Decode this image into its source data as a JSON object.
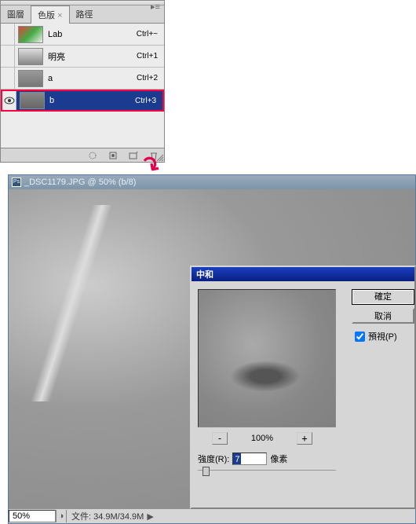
{
  "panel": {
    "tabs": [
      "圖層",
      "色版",
      "路徑"
    ],
    "active_tab_index": 1,
    "channels": [
      {
        "name": "Lab",
        "shortcut": "Ctrl+~",
        "thumb": "lab",
        "visible": false,
        "selected": false
      },
      {
        "name": "明亮",
        "shortcut": "Ctrl+1",
        "thumb": "light",
        "visible": false,
        "selected": false
      },
      {
        "name": "a",
        "shortcut": "Ctrl+2",
        "thumb": "a",
        "visible": false,
        "selected": false
      },
      {
        "name": "b",
        "shortcut": "Ctrl+3",
        "thumb": "b",
        "visible": true,
        "selected": true
      }
    ]
  },
  "document": {
    "title": "_DSC1179.JPG @ 50% (b/8)",
    "zoom": "50%",
    "status": "文件: 34.9M/34.9M"
  },
  "dialog": {
    "title": "中和",
    "ok": "確定",
    "cancel": "取消",
    "preview_label": "預視(P)",
    "preview_checked": true,
    "zoom_out": "-",
    "zoom_in": "+",
    "zoom_pct": "100%",
    "strength_label": "強度(R):",
    "strength_value": "7",
    "strength_unit": "像素"
  }
}
